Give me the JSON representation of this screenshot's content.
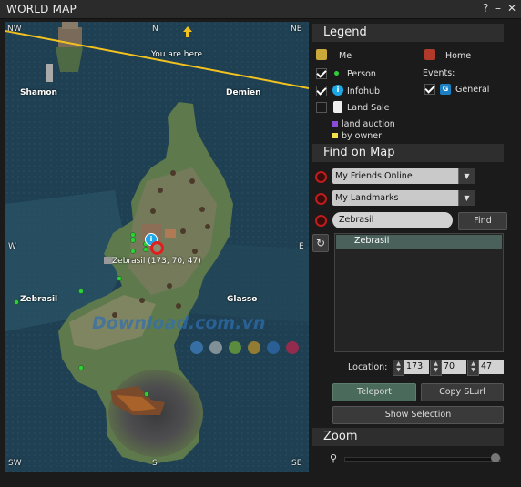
{
  "window": {
    "title": "WORLD MAP",
    "help_label": "?",
    "minimize_label": "–",
    "close_label": "✕"
  },
  "map": {
    "compass": {
      "nw": "NW",
      "n": "N",
      "ne": "NE",
      "w": "W",
      "e": "E",
      "sw": "SW",
      "s": "S",
      "se": "SE"
    },
    "you_are_here": "You are here",
    "regions": [
      "Shamon",
      "Demien",
      "Zebrasil",
      "Glasso"
    ],
    "selection_label": "Zebrasil (173, 70, 47)",
    "watermark": "Download.com.vn",
    "watermark_dot_colors": [
      "#3d79b8",
      "#9aa3a8",
      "#6a9e3b",
      "#b08a2c",
      "#2d67a8",
      "#b0264d"
    ]
  },
  "legend": {
    "header": "Legend",
    "me": "Me",
    "home": "Home",
    "person": "Person",
    "infohub": "Infohub",
    "land_sale": "Land Sale",
    "land_auction": "land auction",
    "by_owner": "by owner",
    "events": "Events:",
    "general": "General",
    "general_icon": "G",
    "person_checked": true,
    "infohub_checked": true,
    "land_sale_checked": false,
    "general_checked": true
  },
  "find": {
    "header": "Find on Map",
    "friends_combo": "My Friends Online",
    "landmarks_combo": "My Landmarks",
    "search_value": "Zebrasil",
    "find_button": "Find",
    "results": [
      "Zebrasil"
    ],
    "location_label": "Location:",
    "location": {
      "x": "173",
      "y": "70",
      "z": "47"
    },
    "teleport_button": "Teleport",
    "copy_slurl_button": "Copy SLurl",
    "show_selection_button": "Show Selection"
  },
  "zoom": {
    "header": "Zoom",
    "level_fraction": 1.0
  },
  "colors": {
    "accent": "#4a6a5c",
    "alert_red": "#c21b1b",
    "land_auction": "#8a4cd6",
    "by_owner": "#f4e04a"
  }
}
